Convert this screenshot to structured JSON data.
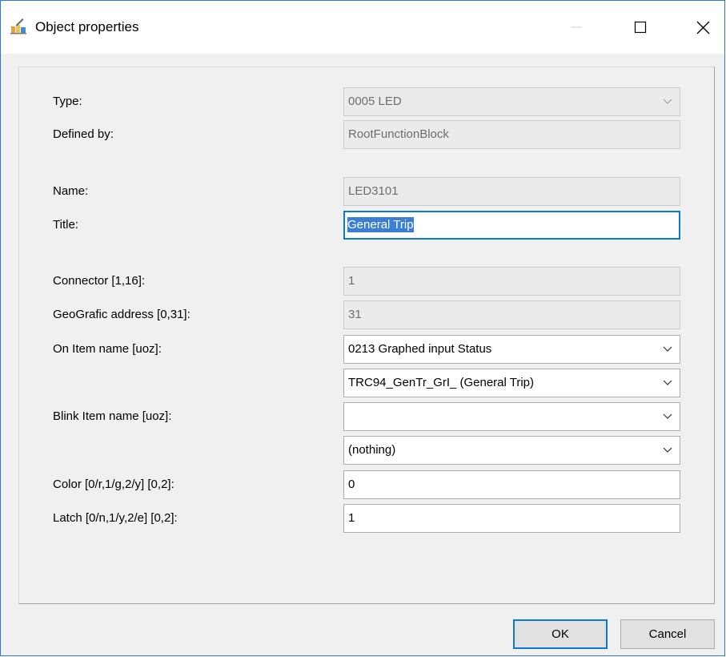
{
  "window": {
    "title": "Object properties",
    "icon": "object-properties-icon"
  },
  "fields": {
    "type": {
      "label": "Type:",
      "value": "0005  LED"
    },
    "defined_by": {
      "label": "Defined by:",
      "value": "RootFunctionBlock"
    },
    "name": {
      "label": "Name:",
      "value": "LED3101"
    },
    "title": {
      "label": "Title:",
      "value": "General Trip"
    },
    "connector": {
      "label": "Connector [1,16]:",
      "value": "1"
    },
    "geografic": {
      "label": "GeoGrafic address [0,31]:",
      "value": "31"
    },
    "on_item": {
      "label": "On Item name [uoz]:",
      "value": "0213  Graphed input Status",
      "value2": "TRC94_GenTr_GrI_ (General Trip)"
    },
    "blink_item": {
      "label": "Blink Item name [uoz]:",
      "value": "",
      "value2": "(nothing)"
    },
    "color": {
      "label": "Color [0/r,1/g,2/y] [0,2]:",
      "value": "0"
    },
    "latch": {
      "label": "Latch [0/n,1/y,2/e] [0,2]:",
      "value": "1"
    }
  },
  "buttons": {
    "ok": "OK",
    "cancel": "Cancel"
  },
  "colors": {
    "accent": "#0a78d7",
    "window_border": "#2b79d6",
    "selection": "#3a7ed6"
  }
}
